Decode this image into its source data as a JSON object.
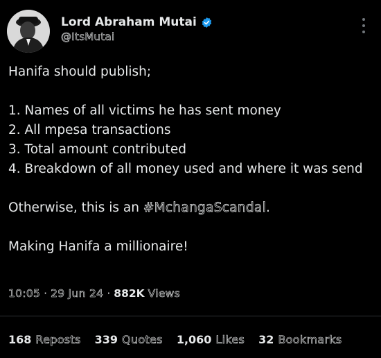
{
  "author": {
    "name": "Lord Abraham Mutai",
    "handle": "@ItsMutai",
    "verified_color": "#1d9bf0"
  },
  "tweet": {
    "line1": "Hanifa should publish;",
    "list": [
      "1. Names of all victims he has sent money",
      "2. All mpesa transactions",
      "3. Total amount contributed",
      "4. Breakdown of all money used and where it was send"
    ],
    "otherwise_prefix": "Otherwise, this is an ",
    "hashtag": "#MchangaScandal",
    "otherwise_suffix": ".",
    "closing": "Making Hanifa a millionaire!"
  },
  "meta": {
    "time": "10:05",
    "date": "29 Jun 24",
    "views_count": "882K",
    "views_label": "Views",
    "separator": "·"
  },
  "stats": {
    "reposts_count": "168",
    "reposts_label": "Reposts",
    "quotes_count": "339",
    "quotes_label": "Quotes",
    "likes_count": "1,060",
    "likes_label": "Likes",
    "bookmarks_count": "32",
    "bookmarks_label": "Bookmarks"
  }
}
